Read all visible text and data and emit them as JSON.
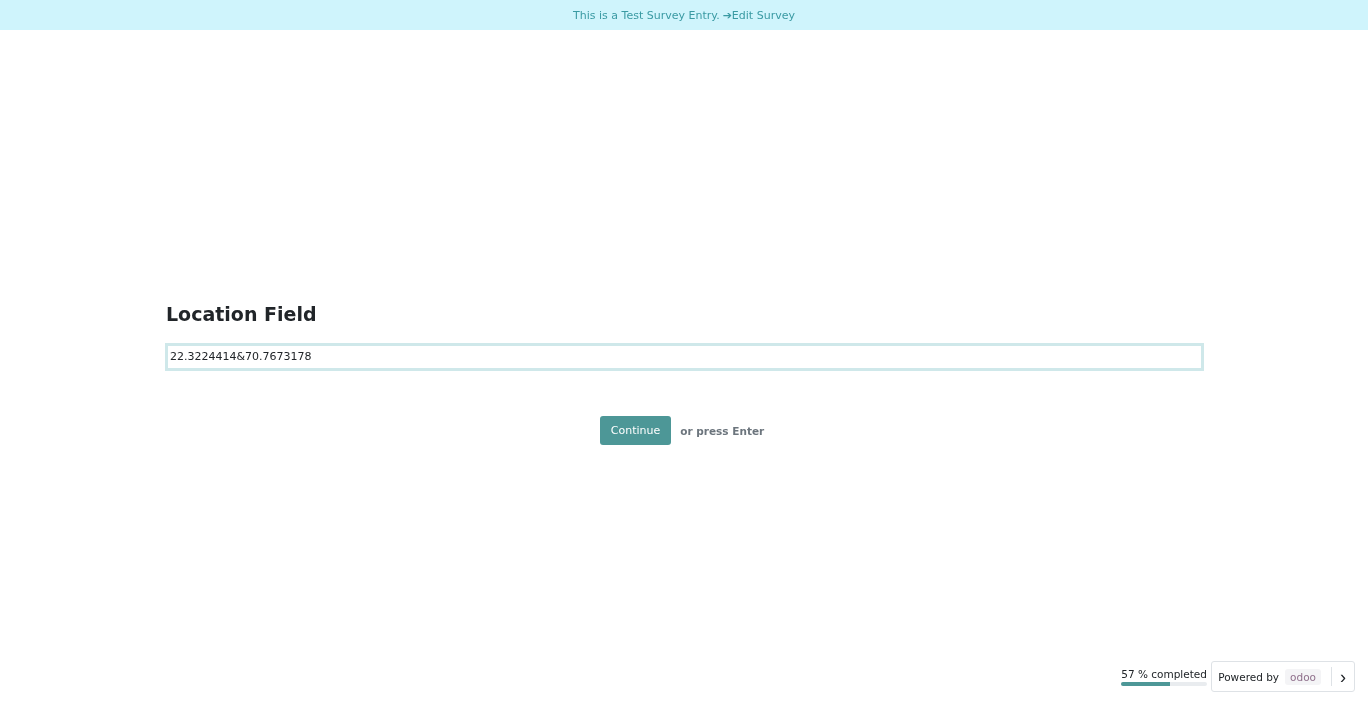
{
  "banner": {
    "text": "This is a Test Survey Entry.",
    "link": "➔Edit Survey"
  },
  "question": {
    "title": "Location Field",
    "value": "22.3224414&70.7673178"
  },
  "actions": {
    "button": "Continue",
    "hint": "or press Enter"
  },
  "progress": {
    "label": "57 % completed",
    "level": 0.57
  },
  "powered_by": {
    "text": "Powered by",
    "brand": "odoo",
    "arrow": "›"
  }
}
